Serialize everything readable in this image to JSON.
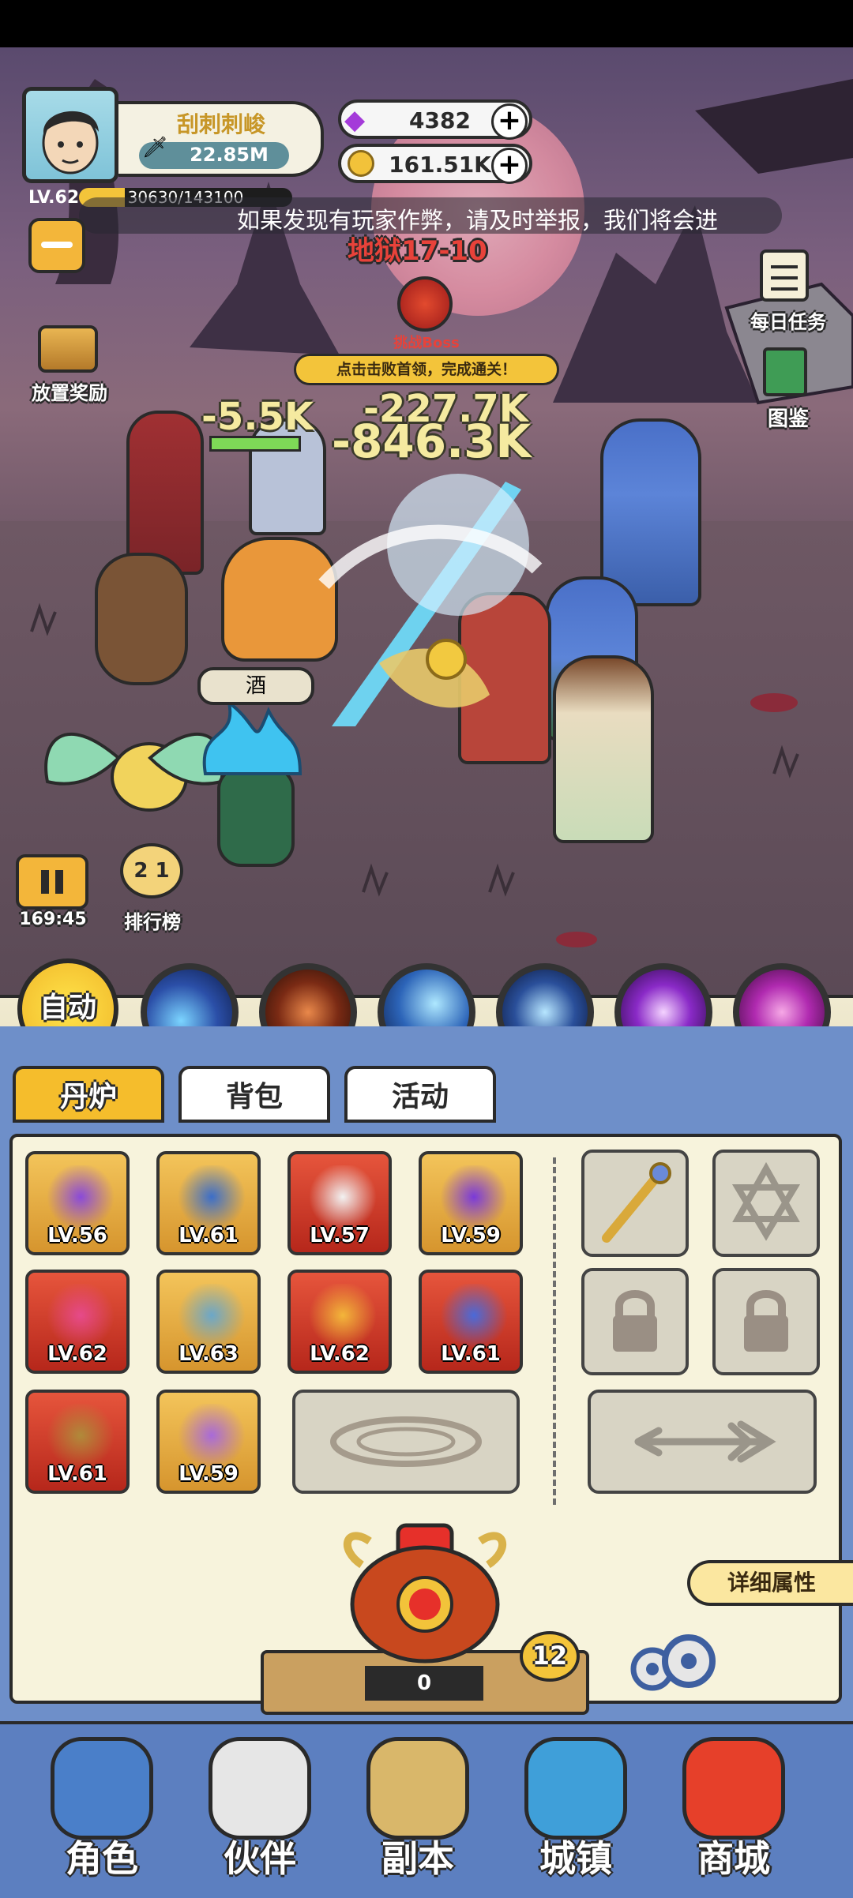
{
  "player": {
    "name": "刮刺刺峻",
    "power": "22.85M",
    "level": "LV.62",
    "exp": "30630/143100",
    "exp_progress": 0.214
  },
  "currency": {
    "gems": "4382",
    "gold": "161.51K"
  },
  "notice": "如果发现有玩家作弊，请及时举报，我们将会进",
  "stage": "地狱17-10",
  "boss": {
    "label": "挑战Boss",
    "hint": "点击击败首领，完成通关！"
  },
  "left_menu": {
    "idle_reward": "放置奖励"
  },
  "right_menu": {
    "daily_tasks": "每日任务",
    "codex": "图鉴"
  },
  "damage": {
    "d1": "-5.5K",
    "d2": "-227.7K",
    "d3": "-846.3K"
  },
  "bottle_label": "酒",
  "timer": "169:45",
  "ranking": "排行榜",
  "auto_button": "自动",
  "tabs": [
    "丹炉",
    "背包",
    "活动"
  ],
  "equipment": [
    {
      "level": "LV.56",
      "item": "sword-icon",
      "frame": "gold"
    },
    {
      "level": "LV.61",
      "item": "helmet-icon",
      "frame": "gold"
    },
    {
      "level": "LV.57",
      "item": "robe-icon",
      "frame": "red"
    },
    {
      "level": "LV.59",
      "item": "orb-icon",
      "frame": "gold"
    },
    {
      "level": "LV.62",
      "item": "lamp-icon",
      "frame": "red"
    },
    {
      "level": "LV.63",
      "item": "bagua-icon",
      "frame": "gold"
    },
    {
      "level": "LV.62",
      "item": "crown-icon",
      "frame": "red"
    },
    {
      "level": "LV.61",
      "item": "amulet-icon",
      "frame": "red"
    },
    {
      "level": "LV.61",
      "item": "ring-icon",
      "frame": "red"
    },
    {
      "level": "LV.59",
      "item": "boots-icon",
      "frame": "gold"
    }
  ],
  "furnace": {
    "count": "0",
    "badge": "12",
    "details_button": "详细属性"
  },
  "nav": [
    "角色",
    "伙伴",
    "副本",
    "城镇",
    "商城"
  ],
  "colors": {
    "panel_bg": "#f7f3dc",
    "tab_active": "#f5bd2c",
    "nav_bg": "#5c7fc0",
    "blue_panel": "#6e8fc9"
  }
}
